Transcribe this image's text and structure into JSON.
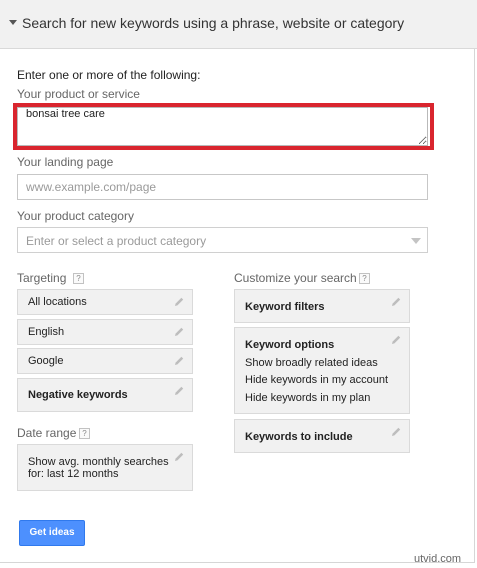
{
  "header": {
    "title": "Search for new keywords using a phrase, website or category"
  },
  "form": {
    "intro": "Enter one or more of the following:",
    "product_label": "Your product or service",
    "product_value": "bonsai tree care",
    "landing_label": "Your landing page",
    "landing_placeholder": "www.example.com/page",
    "category_label": "Your product category",
    "category_placeholder": "Enter or select a product category"
  },
  "targeting": {
    "label": "Targeting",
    "items": [
      "All locations",
      "English",
      "Google",
      "Negative keywords"
    ]
  },
  "date_range": {
    "label": "Date range",
    "line1": "Show avg. monthly searches",
    "line2": "for: last 12 months"
  },
  "customize": {
    "label": "Customize your search",
    "keyword_filters": "Keyword filters",
    "keyword_options": {
      "title": "Keyword options",
      "lines": [
        "Show broadly related ideas",
        "Hide keywords in my account",
        "Hide keywords in my plan"
      ]
    },
    "keywords_to_include": "Keywords to include"
  },
  "help_glyph": "?",
  "button": {
    "label": "Get ideas"
  },
  "watermark": "utvid.com",
  "colors": {
    "highlight": "#d9252e",
    "button": "#4d90fe"
  }
}
